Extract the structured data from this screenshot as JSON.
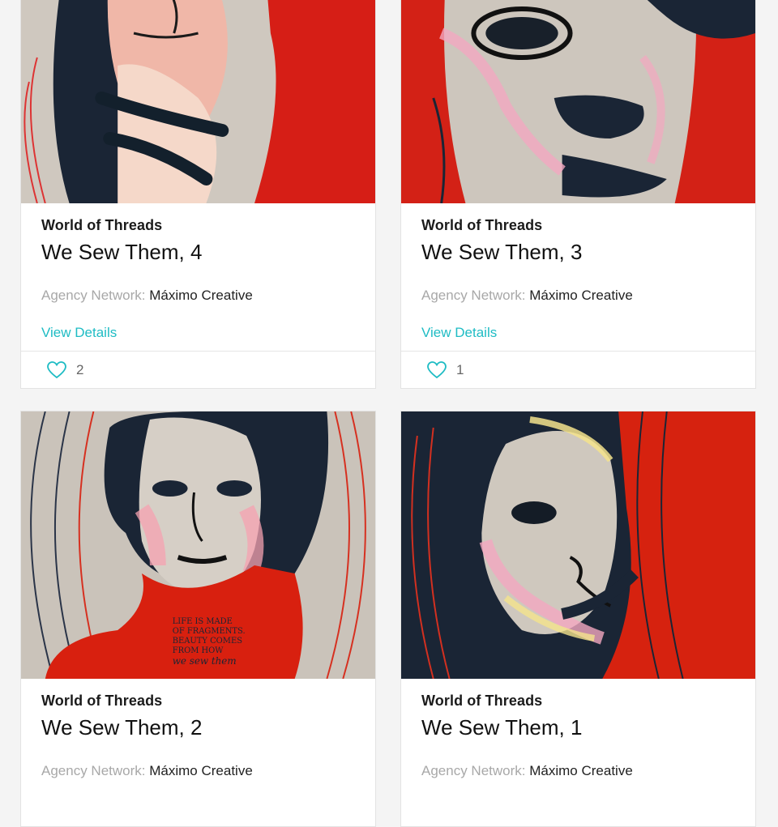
{
  "accent": "#1fbcc4",
  "cards": [
    {
      "collection": "World of Threads",
      "title": "We Sew Them, 4",
      "agency_label": "Agency Network:",
      "agency_value": "Máximo Creative",
      "link": "View Details",
      "likes": "2",
      "like_icon": "heart-outline-icon"
    },
    {
      "collection": "World of Threads",
      "title": "We Sew Them, 3",
      "agency_label": "Agency Network:",
      "agency_value": "Máximo Creative",
      "link": "View Details",
      "likes": "1",
      "like_icon": "heart-outline-icon"
    },
    {
      "collection": "World of Threads",
      "title": "We Sew Them, 2",
      "agency_label": "Agency Network:",
      "agency_value": "Máximo Creative",
      "artwork_text": [
        "LIFE IS MADE",
        "OF FRAGMENTS.",
        "BEAUTY COMES",
        "FROM HOW",
        "we sew them"
      ]
    },
    {
      "collection": "World of Threads",
      "title": "We Sew Them, 1",
      "agency_label": "Agency Network:",
      "agency_value": "Máximo Creative"
    }
  ]
}
